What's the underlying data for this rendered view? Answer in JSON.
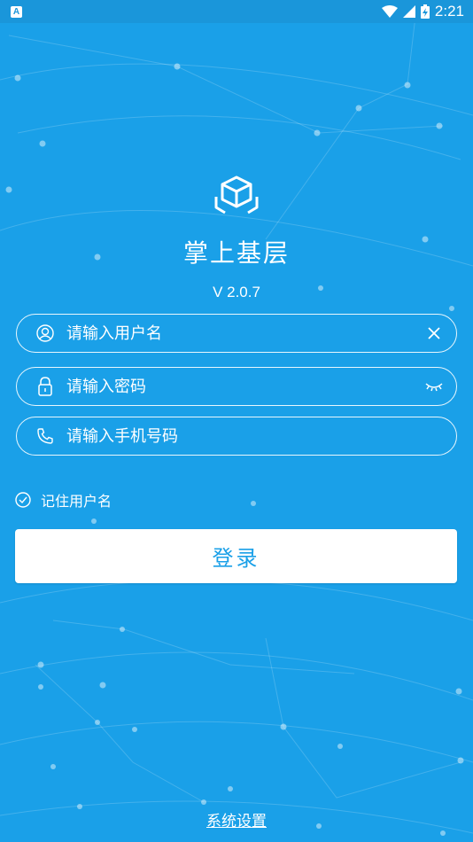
{
  "status_bar": {
    "notification_icon": "app-notification-icon",
    "time": "2:21",
    "wifi_icon": "wifi-icon",
    "signal_icon": "signal-icon",
    "battery_icon": "battery-charging-icon"
  },
  "app": {
    "logo_icon": "cube-logo-icon",
    "title": "掌上基层",
    "version": "V 2.0.7"
  },
  "form": {
    "username": {
      "placeholder": "请输入用户名",
      "icon": "user-icon",
      "trailing_icon": "clear-icon"
    },
    "password": {
      "placeholder": "请输入密码",
      "icon": "lock-icon",
      "trailing_icon": "eye-closed-icon"
    },
    "phone": {
      "placeholder": "请输入手机号码",
      "icon": "phone-icon"
    },
    "remember_label": "记住用户名",
    "remember_checked": true,
    "login_label": "登录"
  },
  "footer": {
    "settings_link": "系统设置"
  },
  "colors": {
    "background": "#1aa0e8",
    "status_bar": "#1a96da",
    "button_text": "#1aa0e8"
  }
}
